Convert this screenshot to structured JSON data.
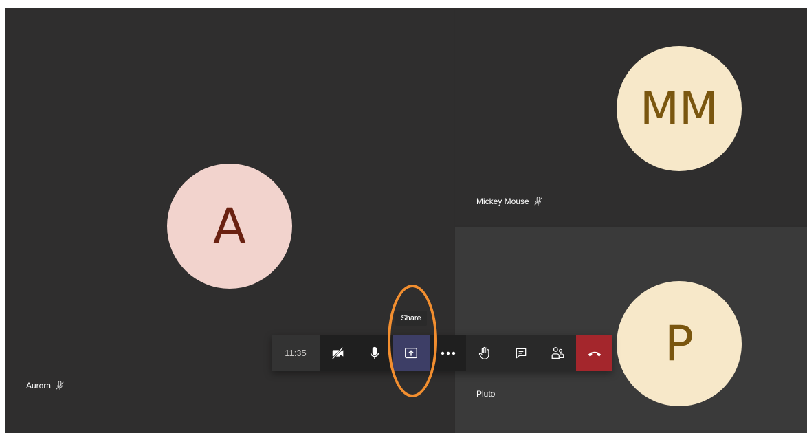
{
  "participants": {
    "aurora": {
      "initials": "A",
      "name": "Aurora",
      "muted_icon": "mic-off-icon"
    },
    "mickey": {
      "initials": "MM",
      "name": "Mickey Mouse",
      "muted_icon": "mic-off-icon"
    },
    "pluto": {
      "initials": "P",
      "name": "Pluto"
    }
  },
  "toolbar": {
    "timer": "11:35",
    "share_tooltip": "Share",
    "buttons": [
      {
        "icon": "video-off-icon"
      },
      {
        "icon": "microphone-icon"
      },
      {
        "icon": "share-screen-icon"
      },
      {
        "icon": "more-options-icon"
      },
      {
        "icon": "raise-hand-icon"
      },
      {
        "icon": "chat-icon"
      },
      {
        "icon": "participants-icon"
      },
      {
        "icon": "hang-up-icon"
      }
    ]
  },
  "colors": {
    "stage_bg": "#2e2d2d",
    "active_button": "#3d3e66",
    "hangup": "#a4262c",
    "highlight": "#f28e2f"
  }
}
